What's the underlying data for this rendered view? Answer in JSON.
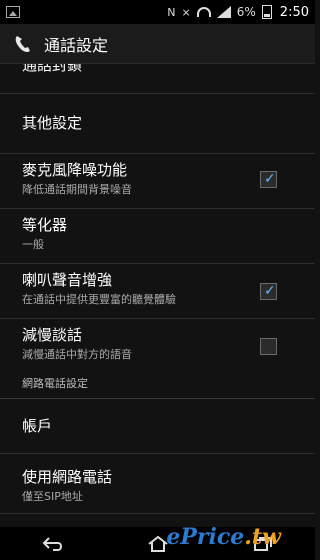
{
  "statusbar": {
    "battery": "6%",
    "time": "2:50"
  },
  "actionbar": {
    "title": "通話設定"
  },
  "list": {
    "partial_top_title": "通話封鎖",
    "other_settings": "其他設定",
    "items": [
      {
        "title": "麥克風降噪功能",
        "subtitle": "降低通話期間背景噪音",
        "checked": true
      },
      {
        "title": "等化器",
        "subtitle": "一般"
      },
      {
        "title": "喇叭聲音增強",
        "subtitle": "在通話中提供更豐富的聽覺體驗",
        "checked": true
      },
      {
        "title": "減慢談話",
        "subtitle": "減慢通話中對方的語音",
        "checked": false
      }
    ],
    "section_header": "網路電話設定",
    "accounts": "帳戶",
    "use_net_call": {
      "title": "使用網路電話",
      "subtitle": "僅至SIP地址"
    }
  },
  "watermark": {
    "text": "ePrice",
    "suffix": ".tw"
  }
}
